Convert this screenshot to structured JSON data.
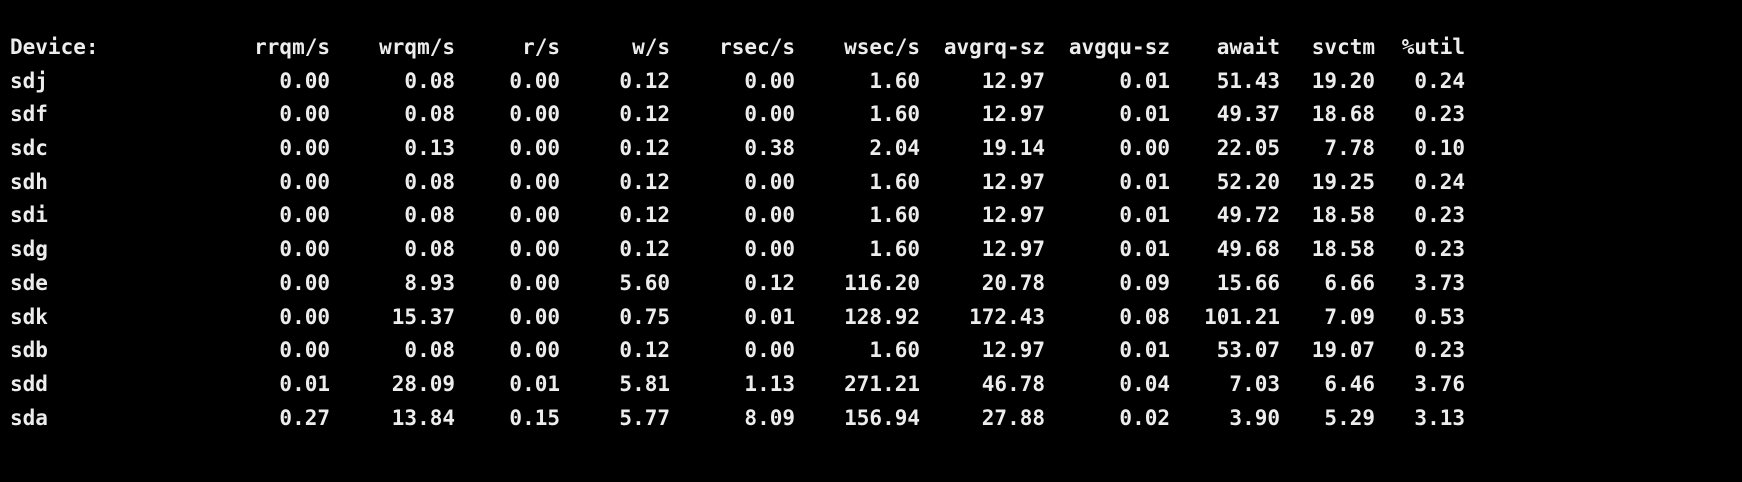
{
  "colors": {
    "background": "#000000",
    "text": "#ededed"
  },
  "headers": [
    "Device:",
    "rrqm/s",
    "wrqm/s",
    "r/s",
    "w/s",
    "rsec/s",
    "wsec/s",
    "avgrq-sz",
    "avgqu-sz",
    "await",
    "svctm",
    "%util"
  ],
  "rows": [
    [
      "sdj",
      "0.00",
      "0.08",
      "0.00",
      "0.12",
      "0.00",
      "1.60",
      "12.97",
      "0.01",
      "51.43",
      "19.20",
      "0.24"
    ],
    [
      "sdf",
      "0.00",
      "0.08",
      "0.00",
      "0.12",
      "0.00",
      "1.60",
      "12.97",
      "0.01",
      "49.37",
      "18.68",
      "0.23"
    ],
    [
      "sdc",
      "0.00",
      "0.13",
      "0.00",
      "0.12",
      "0.38",
      "2.04",
      "19.14",
      "0.00",
      "22.05",
      "7.78",
      "0.10"
    ],
    [
      "sdh",
      "0.00",
      "0.08",
      "0.00",
      "0.12",
      "0.00",
      "1.60",
      "12.97",
      "0.01",
      "52.20",
      "19.25",
      "0.24"
    ],
    [
      "sdi",
      "0.00",
      "0.08",
      "0.00",
      "0.12",
      "0.00",
      "1.60",
      "12.97",
      "0.01",
      "49.72",
      "18.58",
      "0.23"
    ],
    [
      "sdg",
      "0.00",
      "0.08",
      "0.00",
      "0.12",
      "0.00",
      "1.60",
      "12.97",
      "0.01",
      "49.68",
      "18.58",
      "0.23"
    ],
    [
      "sde",
      "0.00",
      "8.93",
      "0.00",
      "5.60",
      "0.12",
      "116.20",
      "20.78",
      "0.09",
      "15.66",
      "6.66",
      "3.73"
    ],
    [
      "sdk",
      "0.00",
      "15.37",
      "0.00",
      "0.75",
      "0.01",
      "128.92",
      "172.43",
      "0.08",
      "101.21",
      "7.09",
      "0.53"
    ],
    [
      "sdb",
      "0.00",
      "0.08",
      "0.00",
      "0.12",
      "0.00",
      "1.60",
      "12.97",
      "0.01",
      "53.07",
      "19.07",
      "0.23"
    ],
    [
      "sdd",
      "0.01",
      "28.09",
      "0.01",
      "5.81",
      "1.13",
      "271.21",
      "46.78",
      "0.04",
      "7.03",
      "6.46",
      "3.76"
    ],
    [
      "sda",
      "0.27",
      "13.84",
      "0.15",
      "5.77",
      "8.09",
      "156.94",
      "27.88",
      "0.02",
      "3.90",
      "5.29",
      "3.13"
    ]
  ]
}
